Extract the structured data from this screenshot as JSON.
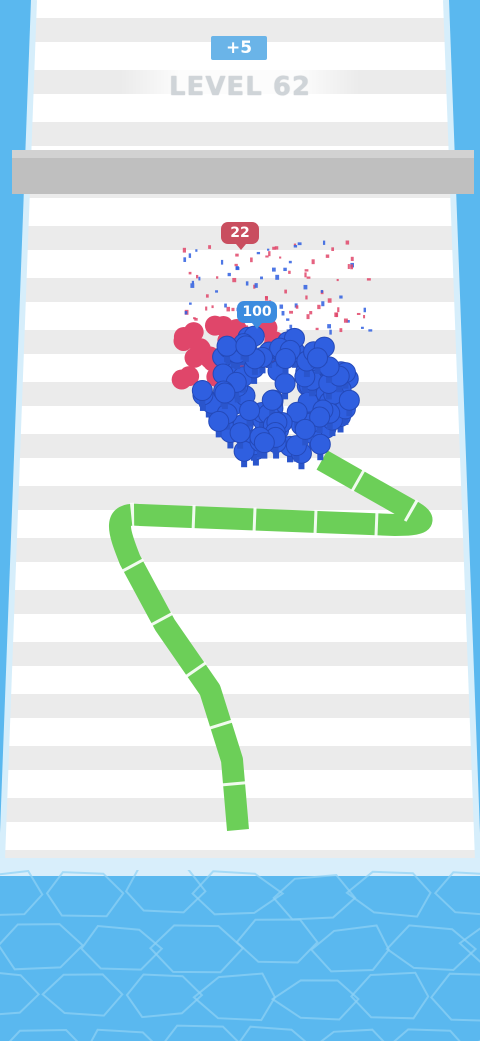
{
  "hud": {
    "bonus": "+5",
    "level": "LEVEL 62"
  },
  "crowd": {
    "enemy_count": "22",
    "player_count": "100"
  },
  "colors": {
    "player": "#2f5fe0",
    "enemy": "#e0466a",
    "path": "#6ccf58",
    "water": "#5ab8ef",
    "track_light": "#ffffff",
    "track_stripe": "#ebebeb",
    "barrier": "#bdbdbd"
  }
}
